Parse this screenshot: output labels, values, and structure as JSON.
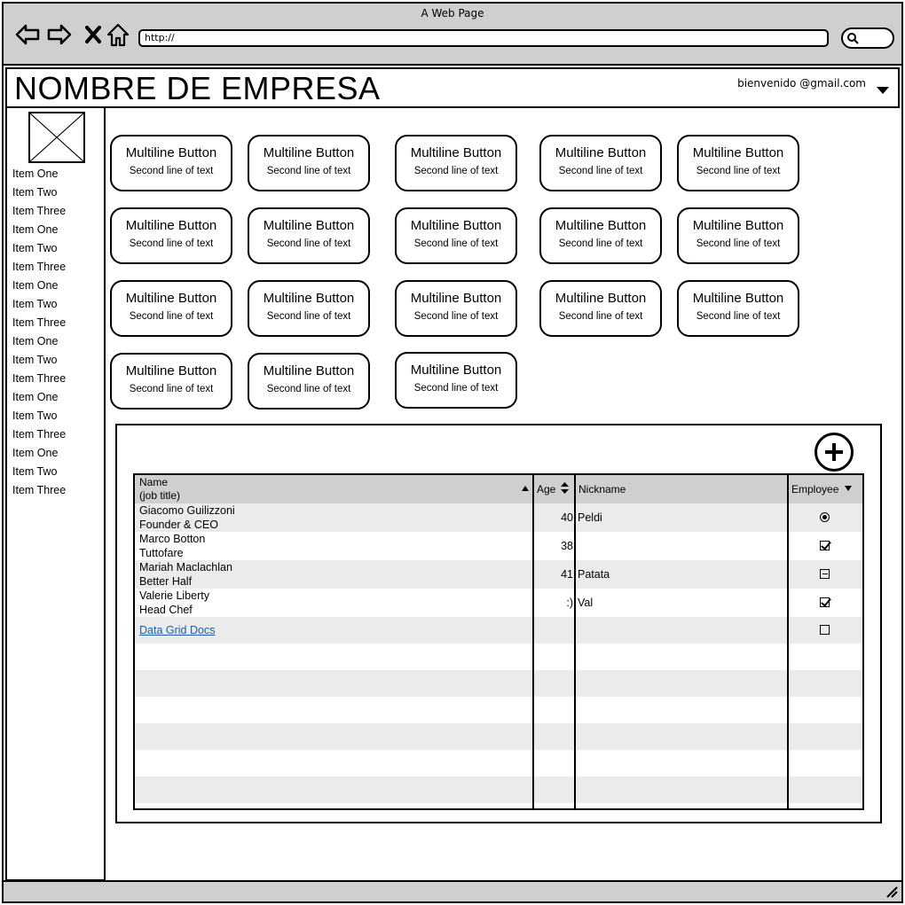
{
  "window": {
    "title": "A Web Page"
  },
  "browser": {
    "url": "http://"
  },
  "header": {
    "company_name": "NOMBRE DE EMPRESA",
    "user_email": "bienvenido @gmail.com"
  },
  "sidebar": {
    "items": [
      "Item One",
      "Item Two",
      "Item Three",
      "Item One",
      "Item Two",
      "Item Three",
      "Item One",
      "Item Two",
      "Item Three",
      "Item One",
      "Item Two",
      "Item Three",
      "Item One",
      "Item Two",
      "Item Three",
      "Item One",
      "Item Two",
      "Item Three"
    ]
  },
  "buttons": {
    "line1": "Multiline Button",
    "line2": "Second line of text"
  },
  "grid": {
    "columns": {
      "name": "Name",
      "name_sub": "(job title)",
      "age": "Age",
      "nickname": "Nickname",
      "employee": "Employee"
    },
    "rows": [
      {
        "name": "Giacomo Guilizzoni",
        "title": "Founder & CEO",
        "age": "40",
        "nickname": "Peldi",
        "employee": "radio"
      },
      {
        "name": "Marco Botton",
        "title": "Tuttofare",
        "age": "38",
        "nickname": "",
        "employee": "checked"
      },
      {
        "name": "Mariah Maclachlan",
        "title": "Better Half",
        "age": "41",
        "nickname": "Patata",
        "employee": "mixed"
      },
      {
        "name": "Valerie Liberty",
        "title": "Head Chef",
        "age": ":)",
        "nickname": "Val",
        "employee": "checked"
      }
    ],
    "link_text": "Data Grid Docs"
  },
  "colors": {
    "chrome": "#cfcfcf",
    "row_alt": "#ebebeb",
    "link": "#1a5fa8"
  }
}
